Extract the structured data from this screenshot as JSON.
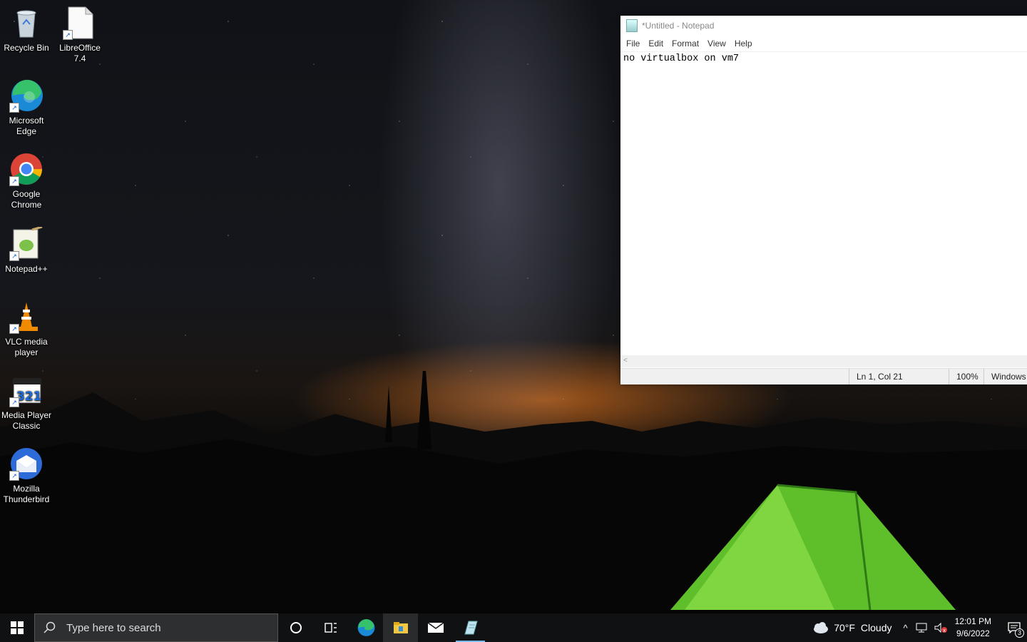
{
  "desktop": {
    "icons": [
      {
        "label": "Recycle Bin",
        "icon": "recycle-bin-icon"
      },
      {
        "label": "LibreOffice 7.4",
        "icon": "libreoffice-icon"
      },
      {
        "label": "Microsoft Edge",
        "icon": "edge-icon"
      },
      {
        "label": "Google Chrome",
        "icon": "chrome-icon"
      },
      {
        "label": "Notepad++",
        "icon": "notepadpp-icon"
      },
      {
        "label": "VLC media player",
        "icon": "vlc-icon"
      },
      {
        "label": "Media Player Classic",
        "icon": "mpc-icon"
      },
      {
        "label": "Mozilla Thunderbird",
        "icon": "thunderbird-icon"
      }
    ]
  },
  "notepad": {
    "title": "*Untitled - Notepad",
    "menu": [
      "File",
      "Edit",
      "Format",
      "View",
      "Help"
    ],
    "content": "no virtualbox on vm7",
    "status": {
      "position": "Ln 1, Col 21",
      "zoom": "100%",
      "line_ending": "Windows"
    }
  },
  "taskbar": {
    "search_placeholder": "Type here to search",
    "pinned": [
      "cortana-icon",
      "task-view-icon",
      "edge-icon",
      "file-explorer-icon",
      "mail-icon",
      "notepad-icon"
    ],
    "weather": {
      "temp": "70°F",
      "condition": "Cloudy"
    },
    "clock": {
      "time": "12:01 PM",
      "date": "9/6/2022"
    },
    "notifications": "3"
  }
}
